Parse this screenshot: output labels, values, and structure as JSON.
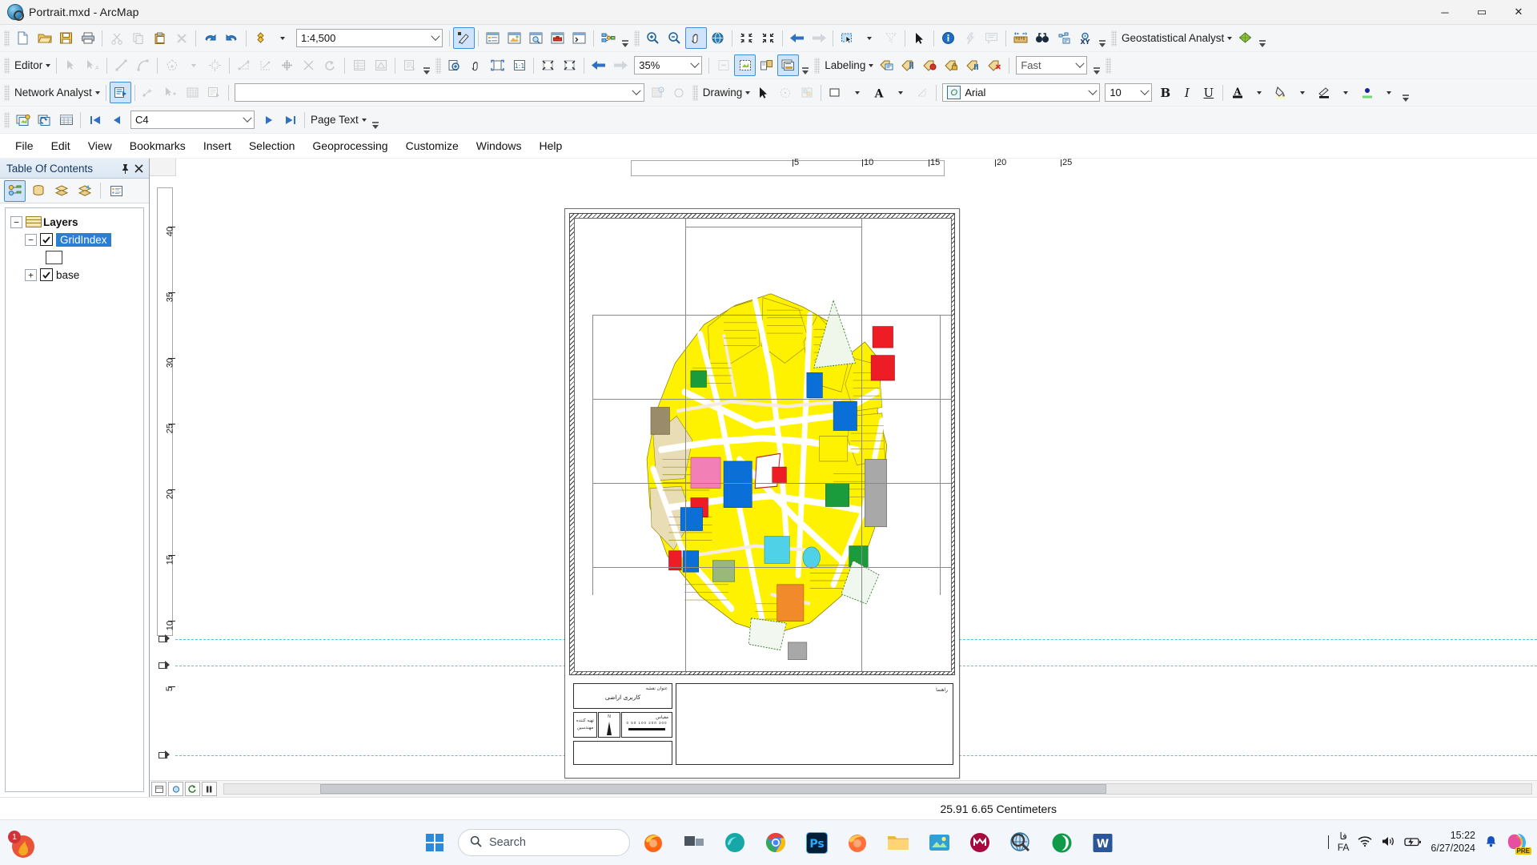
{
  "window": {
    "title": "Portrait.mxd - ArcMap",
    "app_icon": "arcmap-globe-icon",
    "minimize": "─",
    "maximize": "▭",
    "close": "✕"
  },
  "standard_toolbar": {
    "scale_value": "1:4,500",
    "icons": [
      "new-map-icon",
      "open-icon",
      "save-icon",
      "print-icon",
      "cut-icon",
      "copy-icon",
      "paste-icon",
      "delete-icon",
      "undo-icon",
      "redo-icon",
      "add-data-icon"
    ],
    "right_icons": [
      "editor-toolbar-icon",
      "table-of-contents-icon",
      "catalog-icon",
      "search-icon",
      "arctoolbox-icon",
      "python-window-icon",
      "model-builder-icon"
    ]
  },
  "tools_toolbar": {
    "icons": [
      "zoom-in-icon",
      "zoom-out-icon",
      "pan-icon",
      "full-extent-icon",
      "fixed-zoom-in-icon",
      "fixed-zoom-out-icon",
      "go-back-extent-icon",
      "go-next-extent-icon",
      "select-features-icon",
      "clear-selection-icon",
      "select-elements-icon",
      "identify-icon",
      "hyperlink-icon",
      "html-popup-icon",
      "measure-icon",
      "find-icon",
      "find-route-icon",
      "go-to-xy-icon"
    ]
  },
  "extension_toolbar": {
    "label": "Geostatistical Analyst",
    "icon": "geostatistical-wizard-icon"
  },
  "editor_toolbar": {
    "label": "Editor",
    "icons": [
      "edit-tool-icon",
      "edit-annotation-icon",
      "straight-segment-icon",
      "end-point-arc-icon",
      "construction-tool-icon",
      "trace-icon",
      "modify-feature-icon",
      "reshape-feature-icon",
      "split-icon",
      "cut-polygons-icon",
      "rotate-icon",
      "attributes-icon",
      "sketch-properties-icon",
      "create-features-icon"
    ]
  },
  "layout_toolbar": {
    "zoom_value": "35%",
    "icons": [
      "zoom-in-page-icon",
      "pan-page-icon",
      "zoom-whole-page-icon",
      "one-to-one-icon",
      "fixed-zoom-in-page-icon",
      "fixed-zoom-out-page-icon",
      "go-back-page-icon",
      "go-forward-page-icon",
      "toggle-draft-mode-icon",
      "focus-data-frame-icon",
      "change-layout-icon",
      "data-driven-pages-icon"
    ]
  },
  "labeling_toolbar": {
    "label": "Labeling",
    "quality_value": "Fast",
    "icons": [
      "label-manager-icon",
      "label-priority-icon",
      "label-weight-icon",
      "lock-labels-icon",
      "pause-labeling-icon",
      "view-unplaced-labels-icon"
    ]
  },
  "network_analyst_toolbar": {
    "label": "Network Analyst",
    "dataset_value": "",
    "icons": [
      "network-analyst-window-icon",
      "create-location-icon",
      "select-network-location-icon",
      "solve-icon",
      "directions-window-icon",
      "network-identify-icon"
    ]
  },
  "drawing_toolbar": {
    "label": "Drawing",
    "font_name": "Arial",
    "font_size": "10",
    "bold": "B",
    "italic": "I",
    "underline": "U",
    "icons": [
      "select-elements-icon",
      "rotate-element-icon",
      "group-icon",
      "fill-color-icon",
      "font-color-icon",
      "nudge-icon",
      "font-icon",
      "bold-icon",
      "italic-icon",
      "underline-icon",
      "text-color-icon",
      "fill-swatch-icon",
      "line-color-icon",
      "marker-color-icon"
    ]
  },
  "data_driven_pages_toolbar": {
    "page_value": "C4",
    "page_text_label": "Page Text",
    "icons": [
      "ddp-setup-icon",
      "refresh-ddp-icon",
      "page-table-icon",
      "first-page-icon",
      "previous-page-icon",
      "next-page-icon",
      "last-page-icon"
    ]
  },
  "menubar": {
    "items": [
      "File",
      "Edit",
      "View",
      "Bookmarks",
      "Insert",
      "Selection",
      "Geoprocessing",
      "Customize",
      "Windows",
      "Help"
    ]
  },
  "table_of_contents": {
    "title": "Table Of Contents",
    "pin_icon": "pin-icon",
    "close_icon": "close-icon",
    "tool_icons": [
      "list-by-drawing-order-icon",
      "list-by-source-icon",
      "list-by-visibility-icon",
      "list-by-selection-icon",
      "options-icon"
    ],
    "tree": {
      "root": {
        "label": "Layers",
        "expander": "−",
        "icon": "layers-icon"
      },
      "items": [
        {
          "label": "GridIndex",
          "expander": "−",
          "checked": true,
          "selected": true,
          "swatch": "hollow-polygon-swatch"
        },
        {
          "label": "base",
          "expander": "+",
          "checked": true,
          "selected": false
        }
      ]
    }
  },
  "rulers": {
    "horizontal_ticks": [
      "5",
      "10",
      "15",
      "20",
      "25"
    ],
    "vertical_ticks": [
      "40",
      "35",
      "30",
      "25",
      "20",
      "15",
      "10",
      "5"
    ],
    "units": "Centimeters"
  },
  "layout_page": {
    "title_box_label_small": "عنوان نقشه",
    "title_box_text": "کاربری اراضی",
    "legend_label": "راهنما",
    "scale_label": "مقیاس",
    "scale_numbers": "0   50  100      200      300",
    "north_label": "N",
    "info_box_line1": "تهیه کننده",
    "info_box_line2": "مهندسین"
  },
  "statusbar": {
    "coordinates": "25.91  6.65  Centimeters"
  },
  "taskbar": {
    "start_icon": "windows-start-icon",
    "search_placeholder": "Search",
    "search_icon": "search-icon",
    "apps": [
      "firefox-icon",
      "task-view-icon",
      "edge-dev-icon",
      "chrome-icon",
      "photoshop-icon",
      "firefox-browser-icon",
      "file-explorer-icon",
      "photos-icon",
      "mendeley-icon",
      "arcmap-icon",
      "eset-icon",
      "word-icon"
    ],
    "tray": {
      "overflow_icon": "show-hidden-icons-icon",
      "language_top": "فا",
      "language_bottom": "FA",
      "wifi_icon": "wifi-icon",
      "volume_icon": "volume-icon",
      "battery_icon": "battery-charging-icon",
      "time": "15:22",
      "date": "6/27/2024",
      "notification_icon": "notification-bell-icon",
      "copilot_icon": "copilot-pre-icon",
      "copilot_badge": "PRE"
    },
    "notification_badge": "1"
  },
  "colors": {
    "accent": "#2a7fd4",
    "toolbar_bg": "#f5f6f7",
    "title_bg": "#f3f3f3",
    "map_yellow": "#fff200",
    "map_red": "#ee1c25",
    "map_blue": "#0b6fd8",
    "map_green": "#1a9b3c",
    "map_pink": "#f27fb5",
    "map_gray": "#a8a8a8",
    "guide_cyan": "#49c6e8"
  }
}
